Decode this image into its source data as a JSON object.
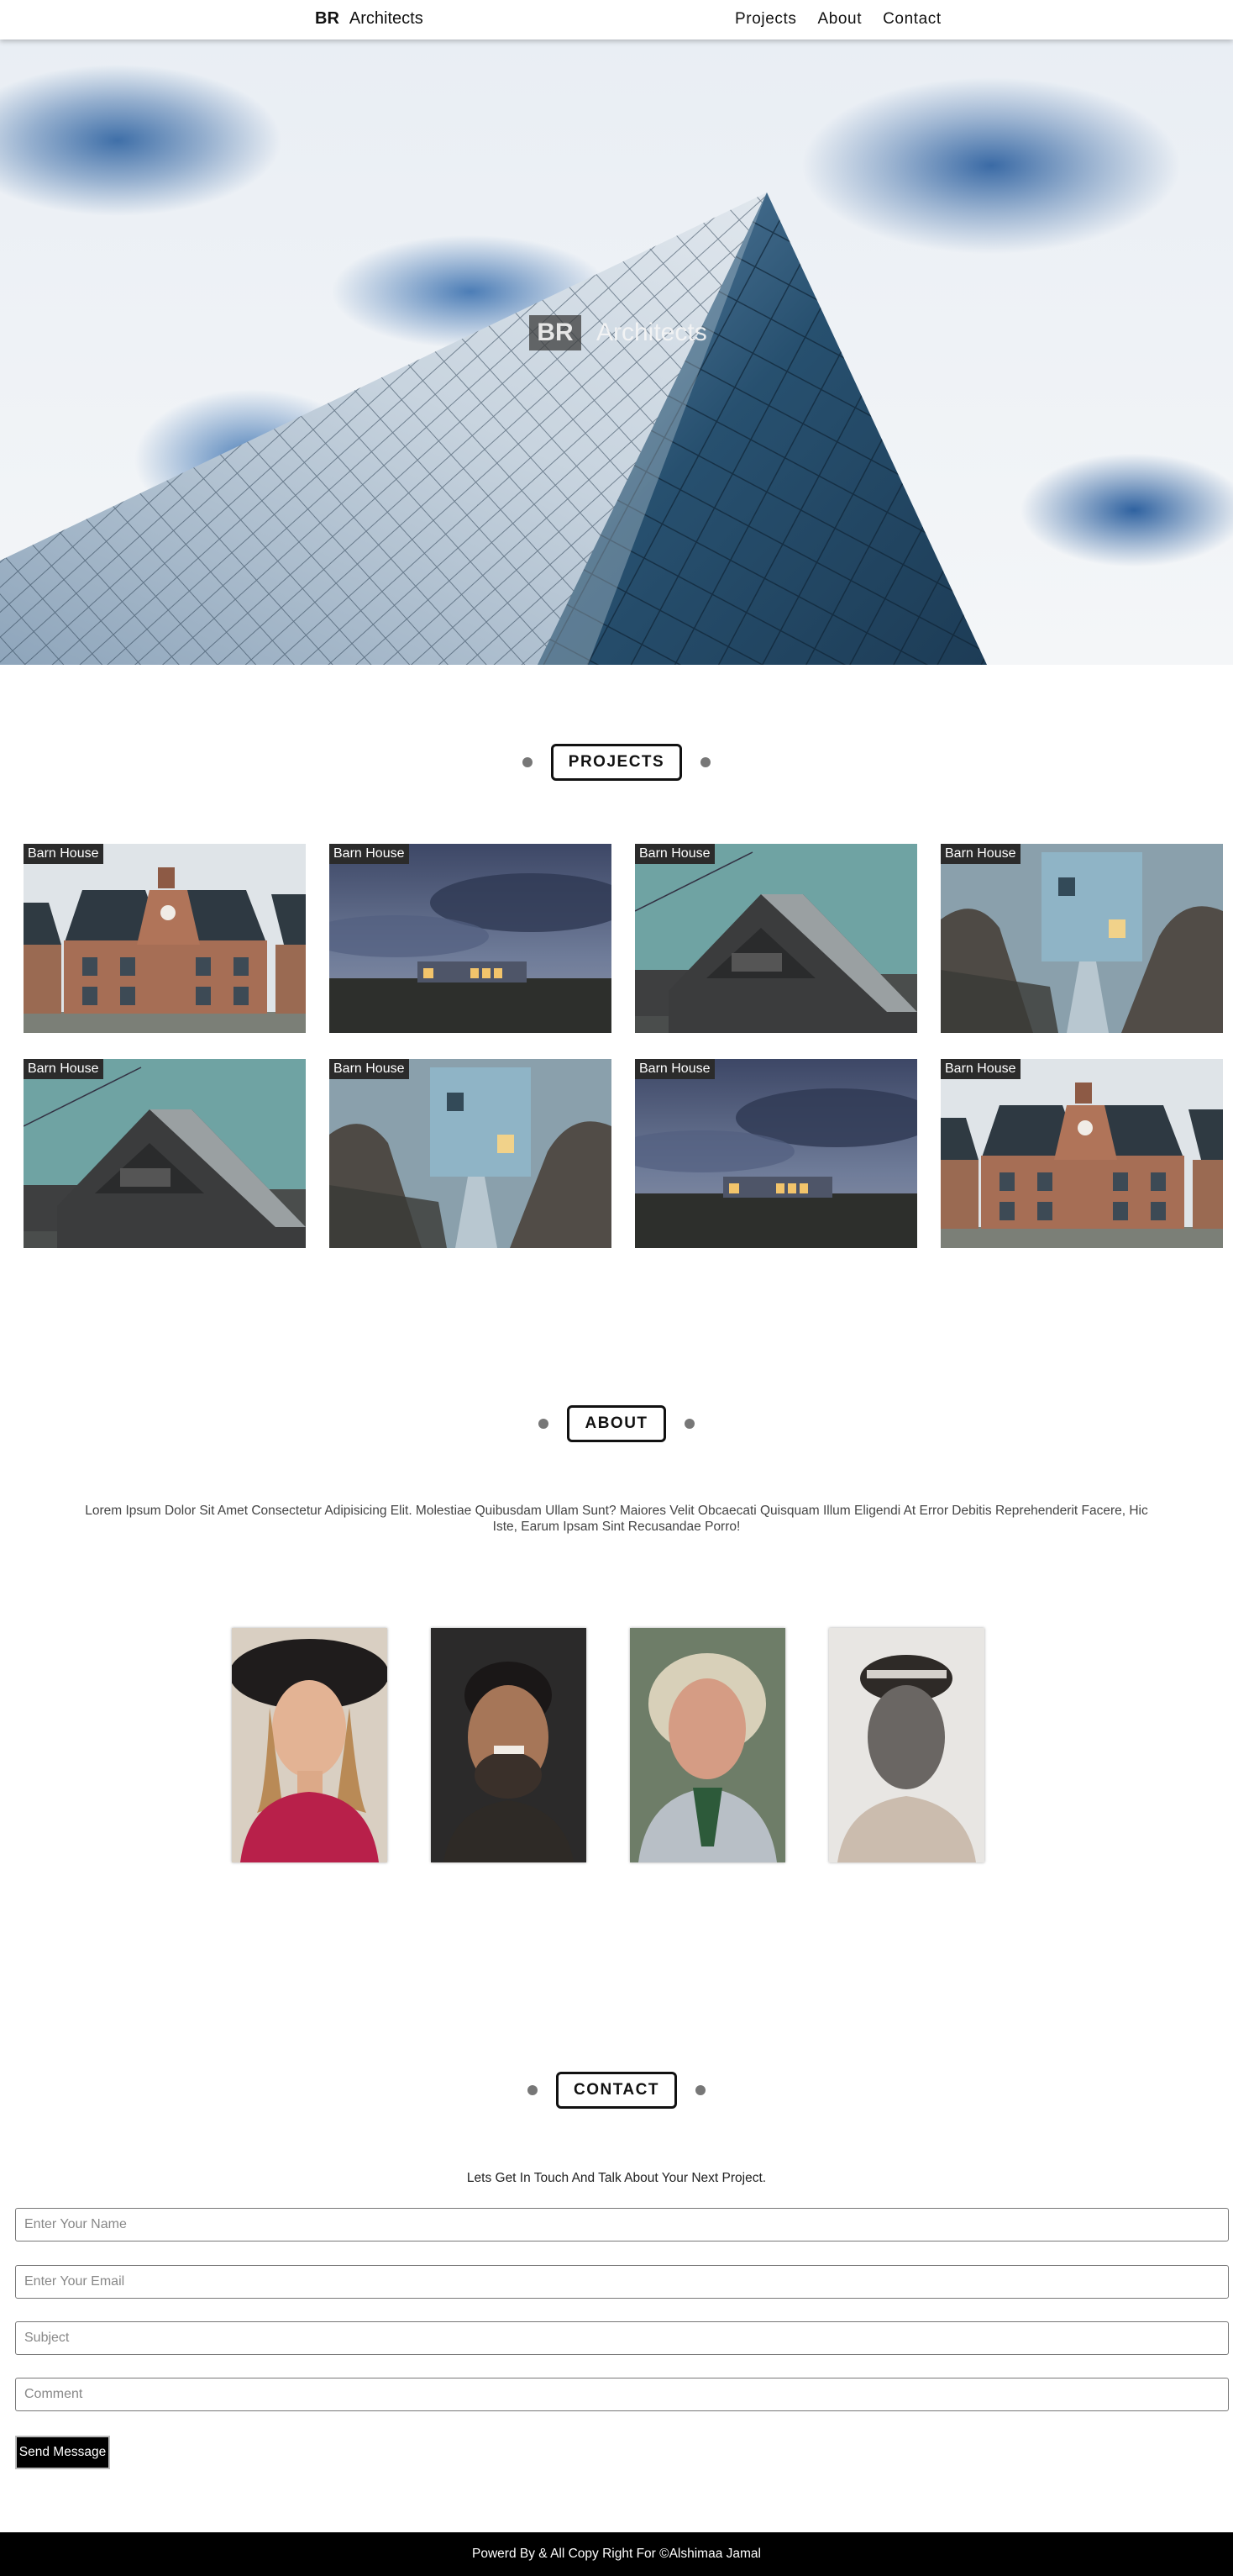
{
  "nav": {
    "brand_short": "BR",
    "brand_name": "Architects",
    "links": [
      "Projects",
      "About",
      "Contact"
    ]
  },
  "hero": {
    "brand_short": "BR",
    "brand_name": "Architects"
  },
  "projects": {
    "heading": "PROJECTS",
    "items": [
      {
        "label": "Barn House",
        "scene": "brick-house"
      },
      {
        "label": "Barn House",
        "scene": "night-field"
      },
      {
        "label": "Barn House",
        "scene": "dark-barn"
      },
      {
        "label": "Barn House",
        "scene": "blue-house"
      },
      {
        "label": "Barn House",
        "scene": "dark-barn"
      },
      {
        "label": "Barn House",
        "scene": "blue-house"
      },
      {
        "label": "Barn House",
        "scene": "night-field"
      },
      {
        "label": "Barn House",
        "scene": "brick-house"
      }
    ]
  },
  "about": {
    "heading": "ABOUT",
    "text": "Lorem Ipsum Dolor Sit Amet Consectetur Adipisicing Elit. Molestiae Quibusdam Ullam Sunt? Maiores Velit Obcaecati Quisquam Illum Eligendi At Error Debitis Reprehenderit Facere, Hic Iste, Earum Ipsam Sint Recusandae Porro!",
    "team_count": 4
  },
  "contact": {
    "heading": "CONTACT",
    "lead": "Lets Get In Touch And Talk About Your Next Project.",
    "name_placeholder": "Enter Your Name",
    "email_placeholder": "Enter Your Email",
    "subject_placeholder": "Subject",
    "comment_placeholder": "Comment",
    "send_label": "Send Message"
  },
  "footer": {
    "text": "Powerd By & All Copy Right For ©Alshimaa Jamal"
  }
}
